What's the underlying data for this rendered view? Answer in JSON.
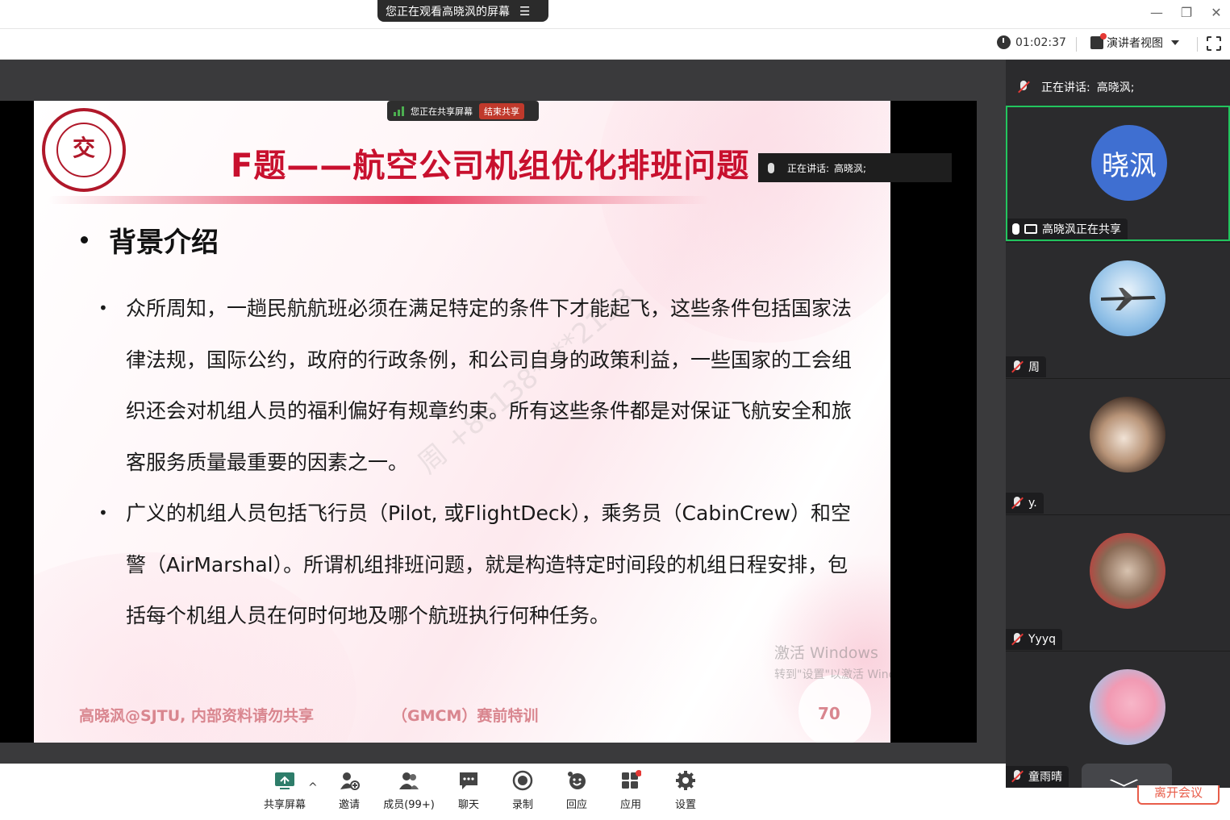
{
  "window": {
    "share_notice": "您正在观看高晓沨的屏幕",
    "share_menu_glyph": "☰"
  },
  "header": {
    "timer": "01:02:37",
    "view_label": "演讲者视图"
  },
  "slide": {
    "title": "F题——航空公司机组优化排班问题",
    "section": "背景介绍",
    "paragraph1": "众所周知，一趟民航航班必须在满足特定的条件下才能起飞，这些条件包括国家法律法规，国际公约，政府的行政条例，和公司自身的政策利益，一些国家的工会组织还会对机组人员的福利偏好有规章约束。所有这些条件都是对保证飞航安全和旅客服务质量最重要的因素之一。",
    "paragraph2": "广义的机组人员包括飞行员（Pilot, 或FlightDeck），乘务员（CabinCrew）和空警（AirMarshal）。所谓机组排班问题，就是构造特定时间段的机组日程安排，包括每个机组人员在何时何地及哪个航班执行何种任务。",
    "footer_left": "高晓沨@SJTU, 内部资料请勿共享",
    "footer_mid": "（GMCM）赛前特训",
    "page_number": "70",
    "activate_line1": "激活 Windows",
    "activate_line2": "转到\"设置\"以激活 Windows。",
    "watermark": "周 +86138****2153"
  },
  "share_banner": {
    "label": "您正在共享屏幕",
    "end_label": "结束共享"
  },
  "speaking_overlay": {
    "label": "正在讲话:",
    "name": "高晓沨;"
  },
  "right_panel": {
    "speaking_label": "正在讲话:",
    "speaking_name": "高晓沨;",
    "participants": [
      {
        "name": "高晓沨正在共享",
        "avatar_text": "晓沨"
      },
      {
        "name": "周"
      },
      {
        "name": "y."
      },
      {
        "name": "Yyyq"
      },
      {
        "name": "童雨晴"
      }
    ]
  },
  "toolbar": {
    "share": "共享屏幕",
    "invite": "邀请",
    "members": "成员(99+)",
    "chat": "聊天",
    "record": "录制",
    "react": "回应",
    "apps": "应用",
    "settings": "设置",
    "leave": "离开会议"
  },
  "colors": {
    "accent_green": "#22c55e",
    "title_red": "#c8102e",
    "avatar_blue": "#3f6fd1",
    "leave_red": "#e85d4a"
  }
}
